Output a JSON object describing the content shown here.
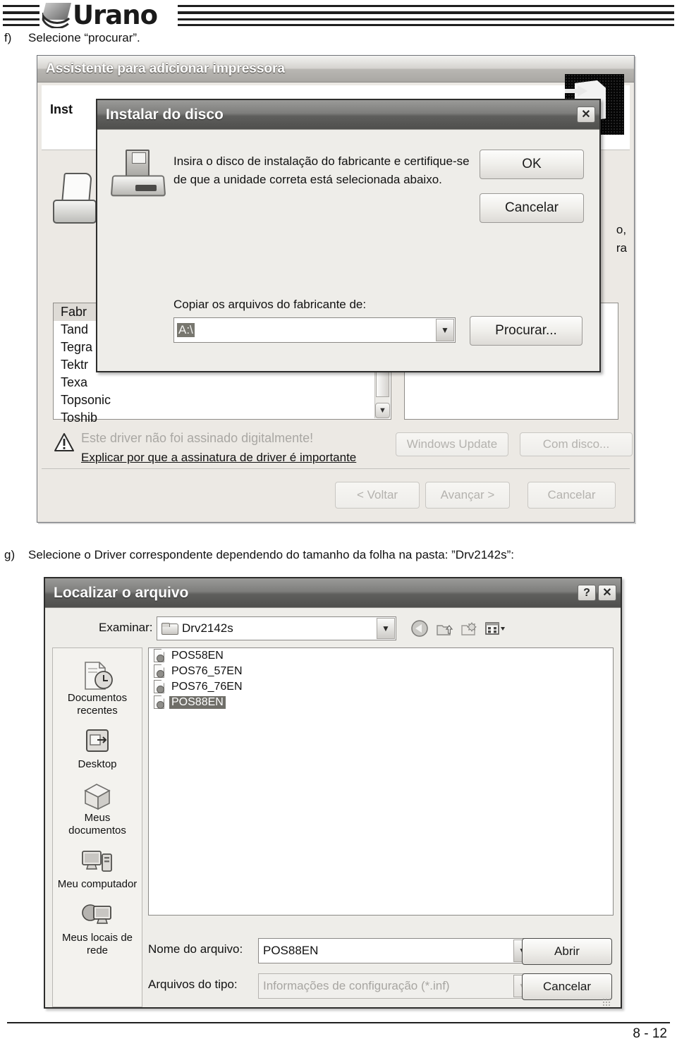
{
  "brand": {
    "name": "Urano"
  },
  "steps": {
    "f": {
      "marker": "f)",
      "text": "Selecione “procurar”."
    },
    "g": {
      "marker": "g)",
      "text": "Selecione o Driver correspondente dependendo do tamanho da folha na pasta: ”Drv2142s”:"
    }
  },
  "wizard": {
    "title": "Assistente para adicionar impressora",
    "heading": "Inst",
    "right_text_line1": "o,",
    "right_text_line2": "ra",
    "manufacturers": [
      {
        "label": "Fabr",
        "header": true
      },
      {
        "label": "Tand",
        "header": false
      },
      {
        "label": "Tegra",
        "header": false
      },
      {
        "label": "Tektr",
        "header": false
      },
      {
        "label": "Texa",
        "header": false
      },
      {
        "label": "Topsonic",
        "header": false
      },
      {
        "label": "Toshib",
        "header": false
      }
    ],
    "warning_text": "Este driver não foi assinado digitalmente!",
    "warning_link": "Explicar por que a assinatura de driver é importante",
    "buttons": {
      "windows_update": "Windows Update",
      "com_disco": "Com disco...",
      "voltar": "< Voltar",
      "avancar": "Avançar >",
      "cancelar": "Cancelar"
    }
  },
  "disk_dialog": {
    "title": "Instalar do disco",
    "close_label": "✕",
    "message_line1": "Insira o disco de instalação do fabricante e certifique-se",
    "message_line2": "de que a unidade correta está selecionada abaixo.",
    "copy_label": "Copiar os arquivos do fabricante de:",
    "copy_value": "A:\\",
    "buttons": {
      "ok": "OK",
      "cancelar": "Cancelar",
      "procurar": "Procurar..."
    }
  },
  "file_dialog": {
    "title": "Localizar o arquivo",
    "help_label": "?",
    "close_label": "✕",
    "look_in_label": "Examinar:",
    "look_in_value": "Drv2142s",
    "toolbar": [
      "back-icon",
      "up-folder-icon",
      "new-folder-icon",
      "views-icon"
    ],
    "places": [
      {
        "label_line1": "Documentos",
        "label_line2": "recentes",
        "icon": "recent-documents-icon"
      },
      {
        "label_line1": "Desktop",
        "label_line2": "",
        "icon": "desktop-icon"
      },
      {
        "label_line1": "Meus",
        "label_line2": "documentos",
        "icon": "my-documents-icon"
      },
      {
        "label_line1": "Meu computador",
        "label_line2": "",
        "icon": "my-computer-icon"
      },
      {
        "label_line1": "Meus locais de",
        "label_line2": "rede",
        "icon": "network-places-icon"
      }
    ],
    "files": [
      {
        "name": "POS58EN",
        "selected": false
      },
      {
        "name": "POS76_57EN",
        "selected": false
      },
      {
        "name": "POS76_76EN",
        "selected": false
      },
      {
        "name": "POS88EN",
        "selected": true
      }
    ],
    "file_name_label": "Nome do arquivo:",
    "file_name_value": "POS88EN",
    "file_type_label": "Arquivos do tipo:",
    "file_type_value": "Informações de configuração (*.inf)",
    "buttons": {
      "abrir": "Abrir",
      "cancelar": "Cancelar"
    }
  },
  "footer": {
    "page": "8 - 12"
  }
}
